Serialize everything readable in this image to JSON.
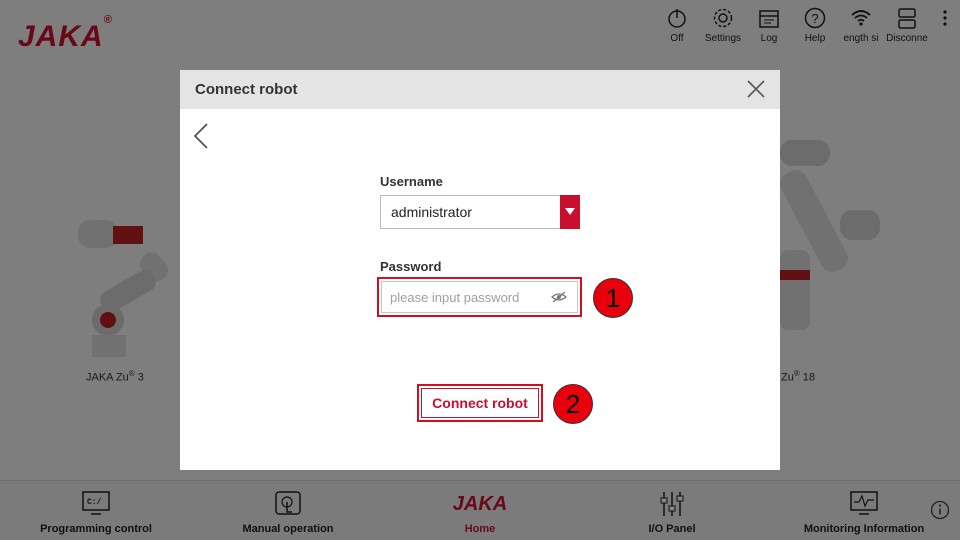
{
  "app": {
    "logo": "JAKA",
    "logo_mark": "®",
    "topbar": [
      {
        "label": "Off",
        "icon": "power-icon"
      },
      {
        "label": "Settings",
        "icon": "gear-icon"
      },
      {
        "label": "Log",
        "icon": "calendar-icon"
      },
      {
        "label": "Help",
        "icon": "question-icon"
      },
      {
        "label": "ength  si",
        "icon": "wifi-icon"
      },
      {
        "label": "Disconne",
        "icon": "disconnect-icon"
      }
    ],
    "robots": {
      "left_label": "JAKA Zu",
      "left_sup": "®",
      "left_num": " 3",
      "right_label": "Zu",
      "right_sup": "®",
      "right_num": " 18"
    },
    "bottombar": [
      {
        "label": "Programming control",
        "icon": "terminal-icon"
      },
      {
        "label": "Manual operation",
        "icon": "touch-icon"
      },
      {
        "label": "Home",
        "icon": "jaka-logo",
        "logo_text": "JAKA"
      },
      {
        "label": "I/O Panel",
        "icon": "sliders-icon"
      },
      {
        "label": "Monitoring Information",
        "icon": "monitor-icon"
      }
    ]
  },
  "dialog": {
    "title": "Connect robot",
    "username_label": "Username",
    "username_value": "administrator",
    "password_label": "Password",
    "password_placeholder": "please input password",
    "connect_label": "Connect robot"
  },
  "annotations": {
    "step1": "1",
    "step2": "2"
  },
  "colors": {
    "brand": "#c8102e",
    "highlight": "#d0101c",
    "badge": "#e8000d"
  }
}
